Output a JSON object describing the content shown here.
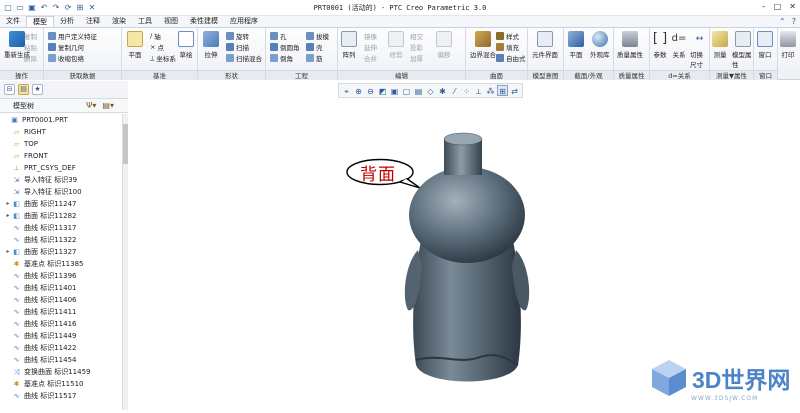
{
  "window": {
    "title": "PRT0001 (活动的) - PTC Creo Parametric 3.0"
  },
  "quick_access": [
    "new-icon",
    "open-icon",
    "save-icon",
    "undo-icon",
    "redo-icon",
    "regenerate-icon",
    "windows-icon",
    "close-icon"
  ],
  "tabs": {
    "file": "文件",
    "items": [
      "模型",
      "分析",
      "注释",
      "渲染",
      "工具",
      "视图",
      "柔性建模",
      "应用程序"
    ],
    "active": "模型"
  },
  "ribbon": {
    "operations": {
      "label": "操作",
      "regenerate": "重新生成",
      "copy": "复制",
      "paste": "粘贴",
      "delete": "删除"
    },
    "get_data": {
      "label": "获取数据",
      "udf": "用户定义特征",
      "copy_geometry": "复制几何",
      "shrinkwrap": "收缩包络"
    },
    "datum": {
      "label": "基准",
      "plane": "平面",
      "axis": "轴",
      "point": "点",
      "csys": "坐标系",
      "sketch": "草绘"
    },
    "shapes": {
      "label": "形状",
      "extrude": "拉伸",
      "revolve": "旋转",
      "sweep": "扫描",
      "swept_blend": "扫描混合"
    },
    "engineering": {
      "label": "工程",
      "hole": "孔",
      "round": "倒圆角",
      "chamfer": "倒角",
      "draft": "拔模",
      "shell": "壳",
      "rib": "筋"
    },
    "editing": {
      "label": "编辑",
      "pattern": "阵列",
      "mirror": "镜像",
      "extend": "延伸",
      "trim": "修剪",
      "merge": "合并",
      "offset": "偏移",
      "intersect": "相交",
      "project": "投影",
      "thicken": "加厚",
      "solidify": "实体化",
      "wrap": "包络"
    },
    "surfaces": {
      "label": "曲面",
      "boundary_blend": "边界混合",
      "style": "样式",
      "fill": "填充",
      "freestyle": "自由式"
    },
    "model_intent": {
      "label": "模型意图",
      "component_interface": "元件界面"
    },
    "section": {
      "label": "截面/外观",
      "plane": "平面",
      "appearance": "外观库"
    },
    "mass": {
      "label": "质量属性",
      "mass_properties": "质量属性"
    },
    "relations": {
      "label": "d=关系",
      "parameters": "参数",
      "relations": "关系",
      "switch_dimensions": "切换尺寸"
    },
    "measure": {
      "label": "测量▼属性",
      "measure": "测量",
      "model_properties": "模型属性"
    },
    "window": {
      "label": "窗口",
      "window": "窗口"
    },
    "print": {
      "label": "",
      "print": "打印"
    }
  },
  "model_tree": {
    "header": "模型树",
    "items": [
      {
        "label": "PRT0001.PRT",
        "icon": "part-icon",
        "expand": ""
      },
      {
        "label": "RIGHT",
        "icon": "datum-plane-icon",
        "expand": ""
      },
      {
        "label": "TOP",
        "icon": "datum-plane-icon",
        "expand": ""
      },
      {
        "label": "FRONT",
        "icon": "datum-plane-icon",
        "expand": ""
      },
      {
        "label": "PRT_CSYS_DEF",
        "icon": "csys-icon",
        "expand": ""
      },
      {
        "label": "导入特征 标识39",
        "icon": "import-icon",
        "expand": ""
      },
      {
        "label": "导入特征 标识100",
        "icon": "import-icon",
        "expand": ""
      },
      {
        "label": "曲面 标识11247",
        "icon": "surface-icon",
        "expand": "▸"
      },
      {
        "label": "曲面 标识11282",
        "icon": "surface-icon",
        "expand": "▸"
      },
      {
        "label": "曲线 标识11317",
        "icon": "curve-icon",
        "expand": ""
      },
      {
        "label": "曲线 标识11322",
        "icon": "curve-icon",
        "expand": ""
      },
      {
        "label": "曲面 标识11327",
        "icon": "surface-icon",
        "expand": "▸"
      },
      {
        "label": "基准点 标识11385",
        "icon": "datum-point-icon",
        "expand": ""
      },
      {
        "label": "曲线 标识11396",
        "icon": "curve-icon",
        "expand": ""
      },
      {
        "label": "曲线 标识11401",
        "icon": "curve-icon",
        "expand": ""
      },
      {
        "label": "曲线 标识11406",
        "icon": "curve-icon",
        "expand": ""
      },
      {
        "label": "曲线 标识11411",
        "icon": "curve-icon",
        "expand": ""
      },
      {
        "label": "曲线 标识11416",
        "icon": "curve-icon",
        "expand": ""
      },
      {
        "label": "曲线 标识11449",
        "icon": "curve-icon",
        "expand": ""
      },
      {
        "label": "曲线 标识11422",
        "icon": "curve-icon",
        "expand": ""
      },
      {
        "label": "曲线 标识11454",
        "icon": "curve-icon",
        "expand": ""
      },
      {
        "label": "变换曲面 标识11459",
        "icon": "transform-icon",
        "expand": ""
      },
      {
        "label": "基准点 标识11510",
        "icon": "datum-point-icon",
        "expand": ""
      },
      {
        "label": "曲线 标识11517",
        "icon": "curve-icon",
        "expand": ""
      }
    ]
  },
  "graphics": {
    "callout": "背面",
    "model_color": "#5d6e7c"
  },
  "watermark": {
    "text": "3D世界网",
    "url": "WWW.3DSJW.COM"
  }
}
